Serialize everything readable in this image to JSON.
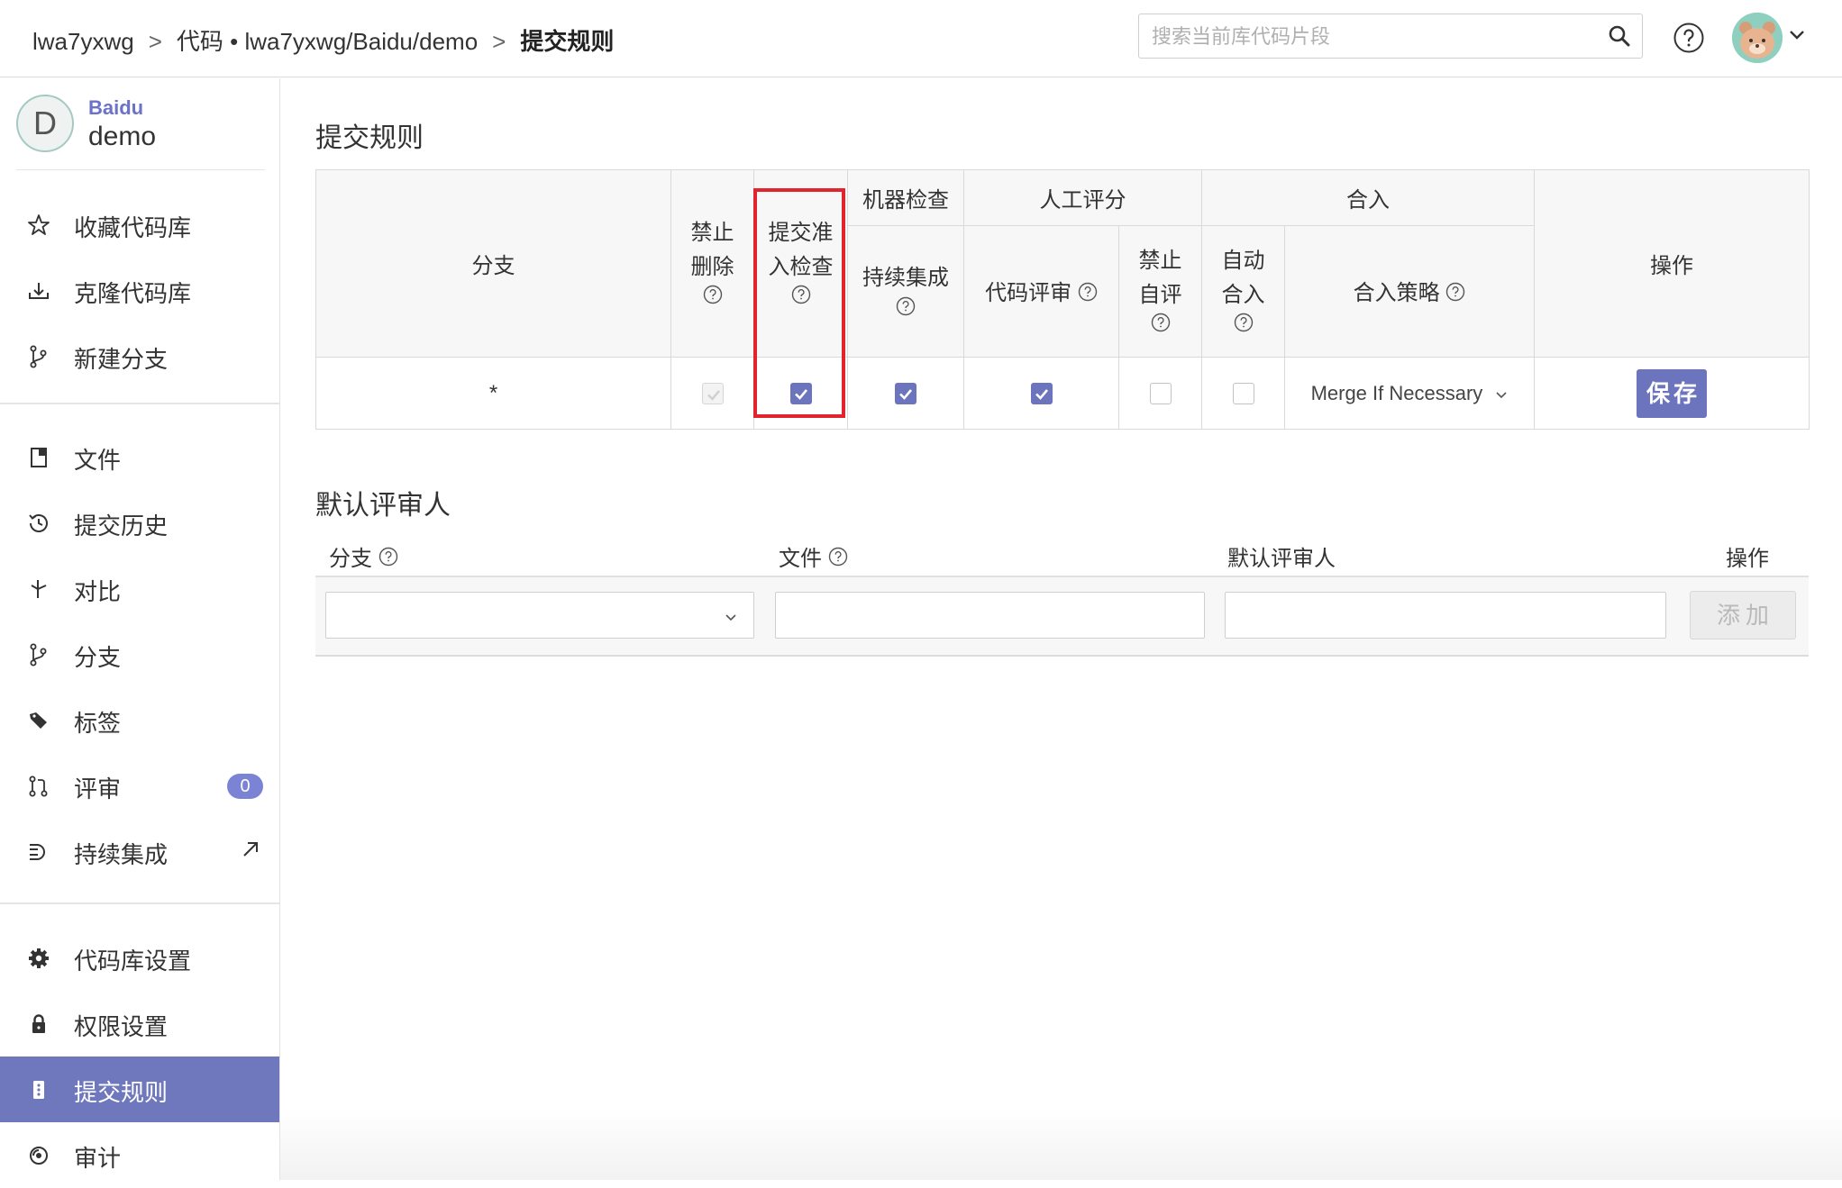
{
  "breadcrumb": {
    "user": "lwa7yxwg",
    "sep1": ">",
    "code": "代码 • lwa7yxwg/Baidu/demo",
    "sep2": ">",
    "current": "提交规则"
  },
  "search": {
    "placeholder": "搜索当前库代码片段",
    "icon": "search-icon"
  },
  "header_icons": {
    "help": "help-icon",
    "avatar": "user-avatar",
    "menu": "chevron-down-icon"
  },
  "repo": {
    "avatar_letter": "D",
    "org": "Baidu",
    "name": "demo"
  },
  "sidebar": {
    "group1": [
      {
        "label": "收藏代码库",
        "icon": "star-icon"
      },
      {
        "label": "克隆代码库",
        "icon": "download-icon"
      },
      {
        "label": "新建分支",
        "icon": "branch-plus-icon"
      }
    ],
    "group2": [
      {
        "label": "文件",
        "icon": "file-icon"
      },
      {
        "label": "提交历史",
        "icon": "history-icon"
      },
      {
        "label": "对比",
        "icon": "compare-icon"
      },
      {
        "label": "分支",
        "icon": "branch-icon"
      },
      {
        "label": "标签",
        "icon": "tag-icon"
      },
      {
        "label": "评审",
        "icon": "pull-request-icon",
        "badge": "0"
      },
      {
        "label": "持续集成",
        "icon": "ci-icon",
        "external": "external-link-icon"
      }
    ],
    "group3": [
      {
        "label": "代码库设置",
        "icon": "gear-icon"
      },
      {
        "label": "权限设置",
        "icon": "lock-icon"
      },
      {
        "label": "提交规则",
        "icon": "rules-icon",
        "active": true
      },
      {
        "label": "审计",
        "icon": "audit-icon"
      }
    ]
  },
  "rules": {
    "title": "提交规则",
    "headers": {
      "branch": "分支",
      "forbid_delete_1": "禁止",
      "forbid_delete_2": "删除",
      "precheck_1": "提交准",
      "precheck_2": "入检查",
      "machine_check": "机器检查",
      "manual_review": "人工评分",
      "merge": "合入",
      "operation": "操作",
      "ci": "持续集成",
      "code_review": "代码评审",
      "forbid_self_1": "禁止",
      "forbid_self_2": "自评",
      "auto_merge_1": "自动",
      "auto_merge_2": "合入",
      "merge_strategy": "合入策略"
    },
    "row": {
      "branch": "*",
      "forbid_delete": true,
      "precheck": true,
      "ci": true,
      "code_review": true,
      "forbid_self": false,
      "auto_merge": false,
      "merge_strategy": "Merge If Necessary",
      "save": "保存"
    }
  },
  "default_reviewers": {
    "title": "默认评审人",
    "headers": {
      "branch": "分支",
      "file": "文件",
      "reviewer": "默认评审人",
      "operation": "操作"
    },
    "add": "添加"
  },
  "colors": {
    "accent": "#6c74bd",
    "highlight": "#e1242d",
    "org": "#6b72c8"
  }
}
